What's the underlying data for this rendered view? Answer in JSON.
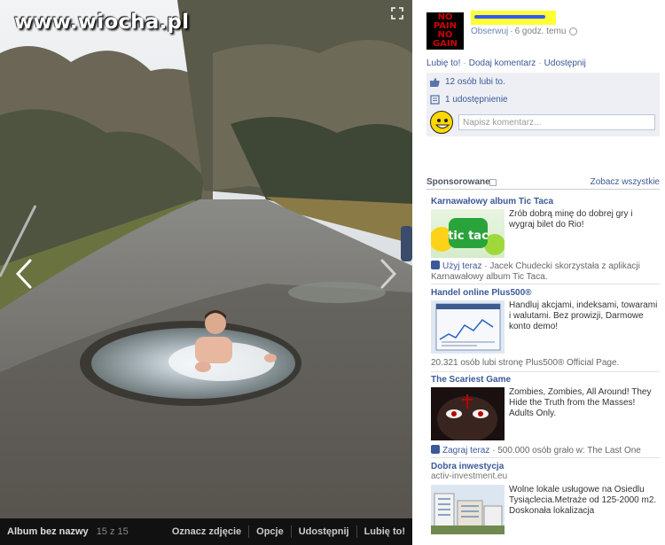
{
  "viewer": {
    "watermark": "www.wiocha.pl",
    "album_title": "Album bez nazwy",
    "photo_count": "15 z 15",
    "actions": [
      "Oznacz zdjęcie",
      "Opcje",
      "Udostępnij",
      "Lubię to!"
    ]
  },
  "post": {
    "page_avatar_lines": [
      "NO",
      "PAIN",
      "NO",
      "GAIN"
    ],
    "follow_label": "Obserwuj",
    "time": "6 godz. temu",
    "actions": [
      "Lubię to!",
      "Dodaj komentarz",
      "Udostępnij"
    ],
    "likes": "12 osób lubi to.",
    "shares": "1 udostępnienie",
    "comment_placeholder": "Napisz komentarz..."
  },
  "sponsored": {
    "title": "Sponsorowane",
    "see_all": "Zobacz wszystkie",
    "ads": [
      {
        "title": "Karnawałowy album Tic Taca",
        "desc": "Zrób dobrą minę do dobrej gry i wygraj bilet do Rio!",
        "image_text": "tic tac",
        "social_action": "Użyj teraz",
        "social_text": "Jacek Chudecki skorzystała z aplikacji Karnawałowy album Tic Taca."
      },
      {
        "title": "Handel online Plus500®",
        "desc": "Handluj akcjami, indeksami, towarami i walutami. Bez prowizji, Darmowe konto demo!",
        "social_text": "20.321 osób lubi stronę Plus500® Official Page."
      },
      {
        "title": "The Scariest Game",
        "desc": "Zombies, Zombies, All Around! They Hide the Truth from the Masses! Adults Only.",
        "social_action": "Zagraj teraz",
        "social_text": "500.000 osób grało w: The Last One"
      },
      {
        "title": "Dobra inwestycja",
        "subtitle": "activ-investment.eu",
        "desc": "Wolne lokale usługowe na Osiedlu Tysiąclecia.Metraże od 125-2000 m2. Doskonała lokalizacja"
      }
    ]
  },
  "colors": {
    "link": "#3b5998",
    "feedback_bg": "#edeff4",
    "viewer_bar": "#111111"
  }
}
